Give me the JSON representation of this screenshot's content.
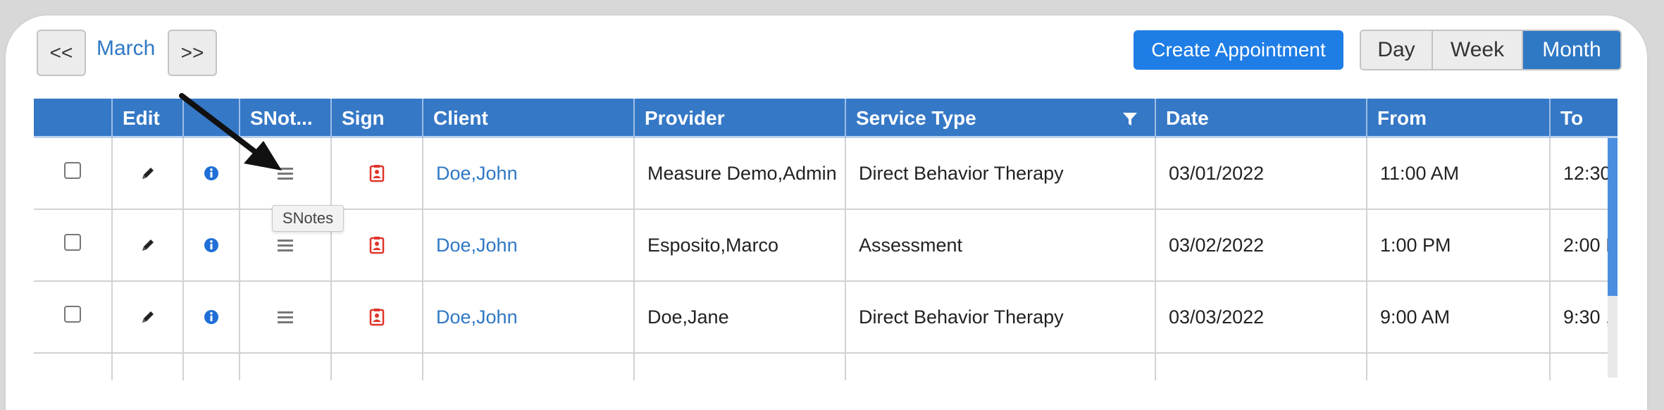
{
  "nav": {
    "prev_label": "<<",
    "month": "March",
    "next_label": ">>"
  },
  "actions": {
    "create_label": "Create Appointment"
  },
  "views": {
    "day": "Day",
    "week": "Week",
    "month": "Month",
    "active": "Month"
  },
  "table": {
    "headers": {
      "select": "",
      "edit": "Edit",
      "info": "",
      "snotes": "SNot...",
      "sign": "Sign",
      "client": "Client",
      "provider": "Provider",
      "service_type": "Service Type",
      "date": "Date",
      "from": "From",
      "to": "To"
    },
    "rows": [
      {
        "client": "Doe,John",
        "provider": "Measure Demo,Admin",
        "service_type": "Direct Behavior Therapy",
        "date": "03/01/2022",
        "from": "11:00 AM",
        "to": "12:30"
      },
      {
        "client": "Doe,John",
        "provider": "Esposito,Marco",
        "service_type": "Assessment",
        "date": "03/02/2022",
        "from": "1:00 PM",
        "to": "2:00 I"
      },
      {
        "client": "Doe,John",
        "provider": "Doe,Jane",
        "service_type": "Direct Behavior Therapy",
        "date": "03/03/2022",
        "from": "9:00 AM",
        "to": "9:30 ,"
      },
      {
        "client": "",
        "provider": "",
        "service_type": "",
        "date": "",
        "from": "",
        "to": ""
      }
    ]
  },
  "tooltip": {
    "text": "SNotes"
  },
  "colors": {
    "header_bg": "#3578c6",
    "accent": "#2f78c4",
    "button_blue": "#1f7de6",
    "sign_red": "#e0342a",
    "info_blue": "#1f6fd6"
  },
  "icons": {
    "edit": "pencil-icon",
    "info": "info-icon",
    "snotes": "menu-lines-icon",
    "sign": "sign-badge-icon",
    "filter": "filter-icon"
  }
}
